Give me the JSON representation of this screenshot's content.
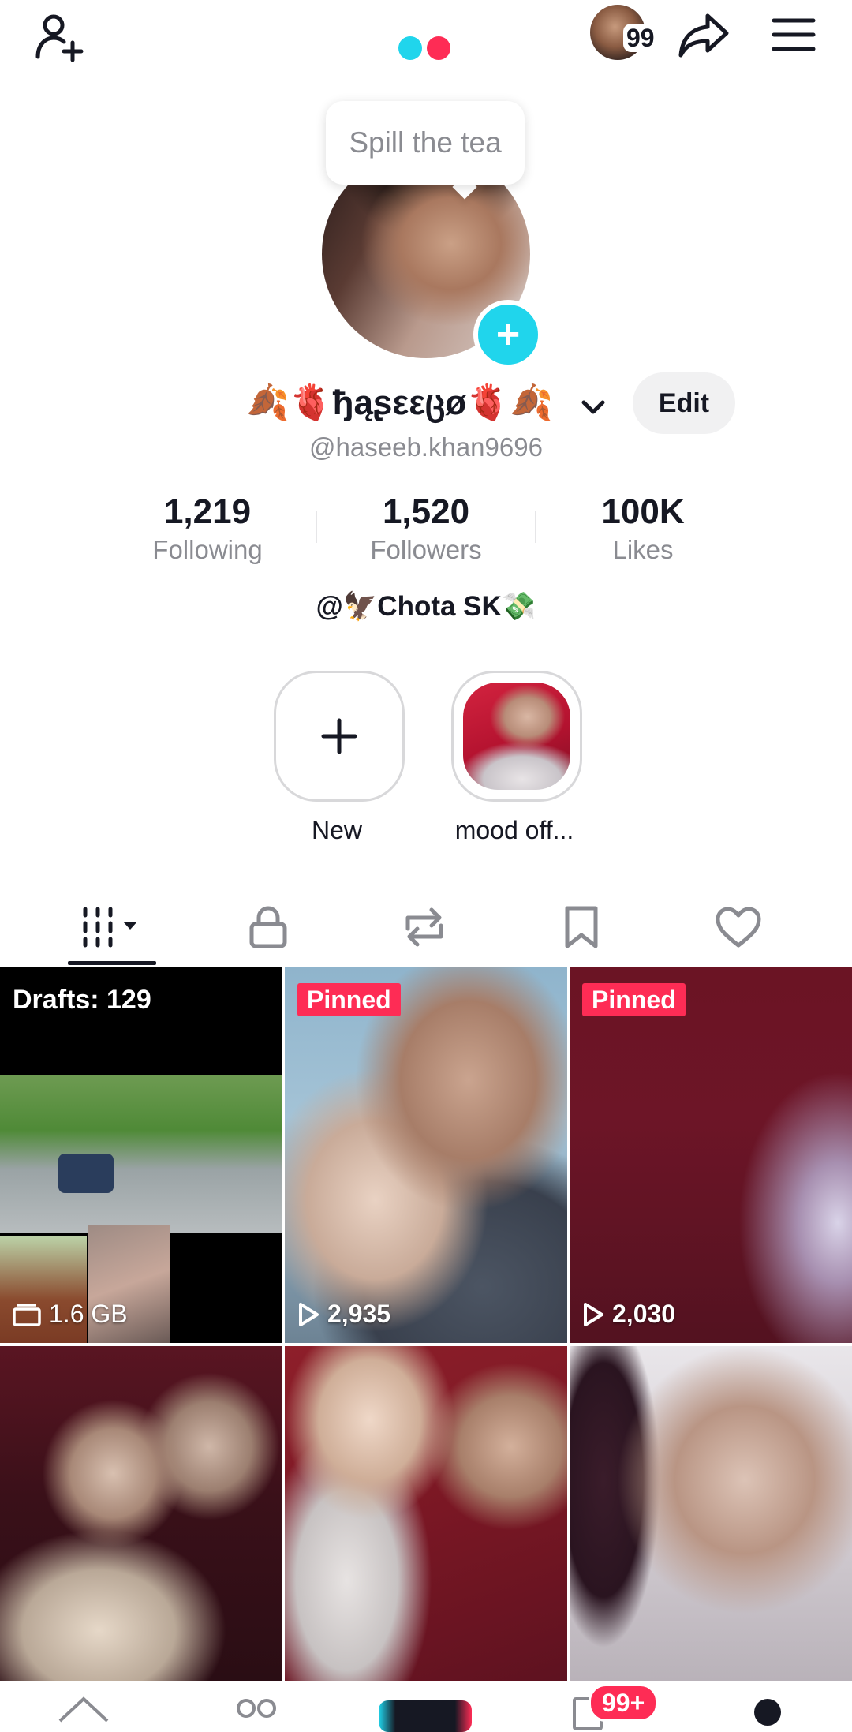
{
  "header": {
    "profile_badge_count": "99",
    "tooltip": "Spill the tea"
  },
  "profile": {
    "display_name": "🍂🫀ђąʂεεცø🫀🍂",
    "edit_label": "Edit",
    "handle": "@haseeb.khan9696",
    "bio": "@🦅Chota SK💸"
  },
  "stats": [
    {
      "value": "1,219",
      "label": "Following"
    },
    {
      "value": "1,520",
      "label": "Followers"
    },
    {
      "value": "100K",
      "label": "Likes"
    }
  ],
  "highlights": [
    {
      "label": "New",
      "icon": "plus-icon"
    },
    {
      "label": "mood off..."
    }
  ],
  "tabs": [
    "videos-grid-icon",
    "lock-icon",
    "repost-icon",
    "bookmark-icon",
    "heart-icon"
  ],
  "grid": {
    "drafts": {
      "label": "Drafts: 129",
      "size": "1.6 GB"
    },
    "pinned_label": "Pinned",
    "tiles": [
      {
        "pinned": true,
        "views": "2,935"
      },
      {
        "pinned": true,
        "views": "2,030"
      }
    ]
  },
  "bottom_nav": {
    "inbox_badge": "99+"
  },
  "colors": {
    "accent_cyan": "#20d5ec",
    "accent_red": "#fe2c55",
    "text_primary": "#161823",
    "text_secondary": "#8a8b91"
  }
}
